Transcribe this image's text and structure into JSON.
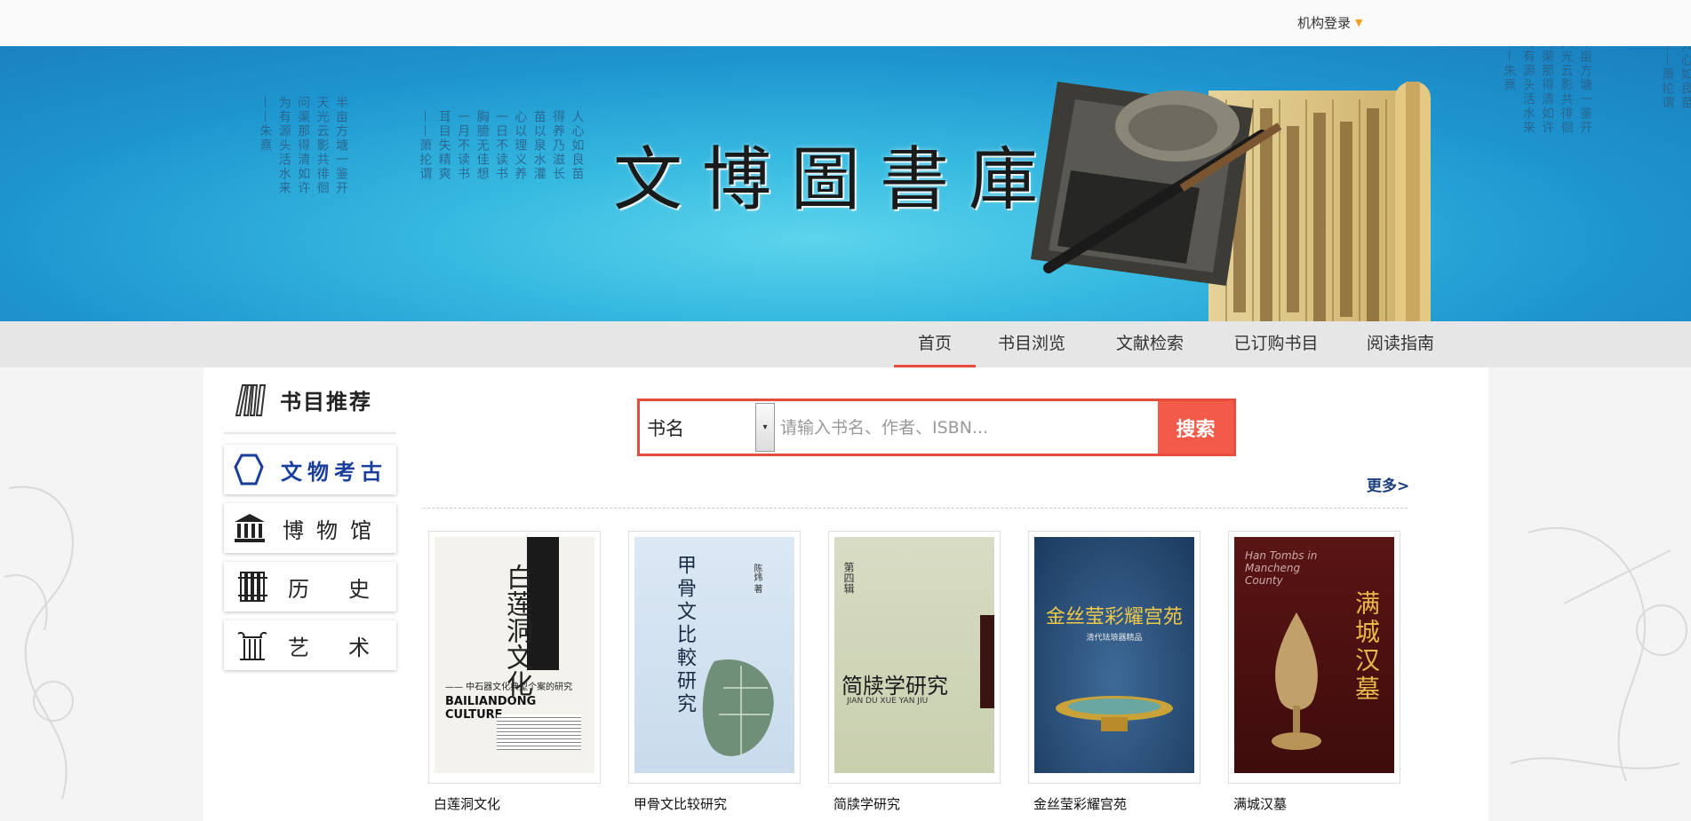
{
  "topbar": {
    "login_label": "机构登录"
  },
  "banner": {
    "brand": "文博圖書庫",
    "poem_left_a": [
      "半亩方塘一鉴开",
      "天光云影共徘徊",
      "问渠那得清如许",
      "为有源头活水来",
      "——朱熹"
    ],
    "poem_left_b": [
      "人心如良苗",
      "得养乃滋长",
      "苗以泉水灌",
      "心以理义养",
      "一日不读书",
      "胸臆无佳想",
      "一月不读书",
      "耳目失精爽",
      "——萧抡谓"
    ],
    "poem_right_a": [
      "半亩方塘一鉴开",
      "天光云影共徘徊",
      "问渠那得清如许",
      "为有源头活水来",
      "——朱熹"
    ],
    "poem_right_b": [
      "人心如良苗",
      "——萧抡谓"
    ]
  },
  "nav": {
    "items": [
      "首页",
      "书目浏览",
      "文献检索",
      "已订购书目",
      "阅读指南"
    ],
    "active_index": 0
  },
  "sidebar": {
    "title": "书目推荐",
    "categories": [
      {
        "label": "文物考古",
        "icon": "pot-icon"
      },
      {
        "label": "博物馆",
        "icon": "museum-icon"
      },
      {
        "label": "历史",
        "icon": "bamboo-slips-icon"
      },
      {
        "label": "艺术",
        "icon": "column-icon"
      }
    ]
  },
  "search": {
    "field_selected": "书名",
    "placeholder": "请输入书名、作者、ISBN...",
    "button_label": "搜索"
  },
  "more_label": "更多>",
  "books": [
    {
      "title": "白莲洞文化",
      "cover_title": "白莲洞文化",
      "cover_en": "BAILIANDONG CULTURE",
      "cover_sub": "—— 中石器文化典型个案的研究"
    },
    {
      "title": "甲骨文比较研究",
      "cover_title": "甲骨文比較研究",
      "cover_author": "陈炜 著"
    },
    {
      "title": "简牍学研究",
      "cover_title": "简牍学研究",
      "cover_en": "JIAN DU XUE YAN JIU",
      "cover_vol": "第四辑"
    },
    {
      "title": "金丝莹彩耀宫苑",
      "cover_title": "金丝莹彩耀宫苑",
      "cover_sub": "清代珐琅器精品"
    },
    {
      "title": "满城汉墓",
      "cover_title": "满城汉墓",
      "cover_en": "Han Tombs in Mancheng County"
    }
  ],
  "colors": {
    "accent": "#e74c3c",
    "search_button": "#f25a4a",
    "more_link": "#1a3e7c",
    "banner": "#36b9e0"
  }
}
